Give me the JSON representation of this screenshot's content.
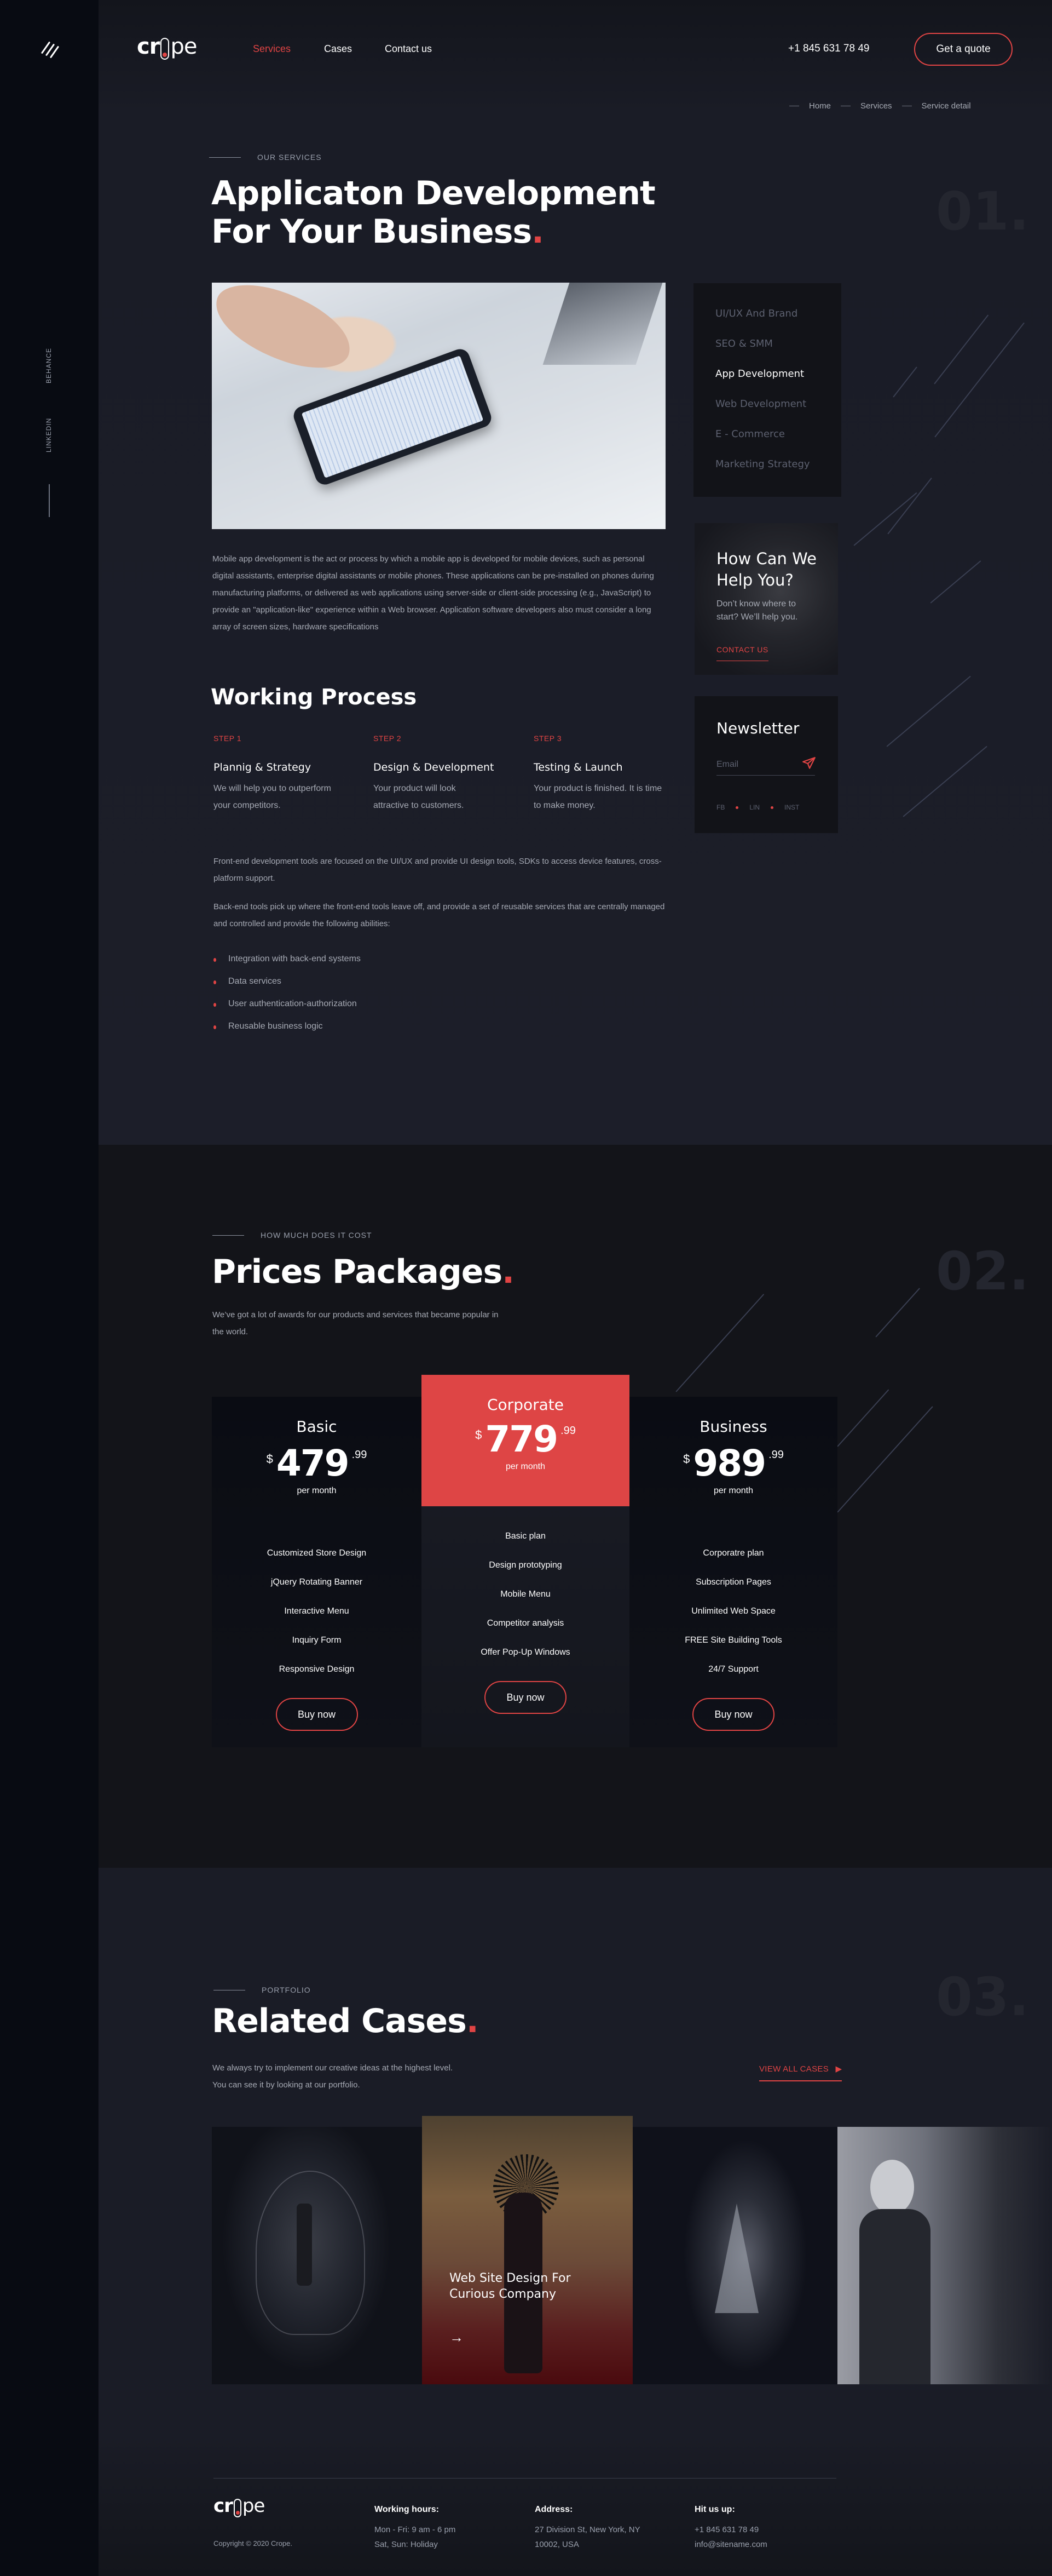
{
  "brand": {
    "logo_left": "cr",
    "logo_right": "pe",
    "accent": "#e04444"
  },
  "sidebar": {
    "social_links": [
      "BEHANCE",
      "LINKEDIN"
    ]
  },
  "header": {
    "nav": [
      {
        "label": "Services",
        "active": true
      },
      {
        "label": "Cases",
        "active": false
      },
      {
        "label": "Contact us",
        "active": false
      }
    ],
    "phone": "+1 845 631 78 49",
    "quote_button": "Get a quote"
  },
  "breadcrumb": [
    "Home",
    "Services",
    "Service detail"
  ],
  "service": {
    "eyebrow": "OUR SERVICES",
    "title_line1": "Applicaton Development",
    "title_line2": "For Your Business",
    "title_dot": ".",
    "section_number": "01.",
    "intro": "Mobile app development is the act or process by which a mobile app is developed for mobile devices, such as personal digital assistants, enterprise digital assistants or mobile phones. These applications can be pre-installed on phones during manufacturing platforms, or delivered as web applications using server-side or client-side processing (e.g., JavaScript) to provide an \"application-like\" experience within a Web browser. Application software developers also must consider a long array of screen sizes, hardware specifications",
    "process_title": "Working Process",
    "steps": [
      {
        "label": "STEP 1",
        "title": "Plannig & Strategy",
        "text": "We will help you to outperform your competitors."
      },
      {
        "label": "STEP 2",
        "title": "Design & Development",
        "text": "Your product will look attractive to customers."
      },
      {
        "label": "STEP 3",
        "title": "Testing & Launch",
        "text": "Your product is finished. It is time to make money."
      }
    ],
    "para2": "Front-end development tools are focused on the UI/UX and provide UI design tools, SDKs to access device features, cross-platform support.",
    "para3": "Back-end tools pick up where the front-end tools leave off, and provide a set of reusable services that are centrally managed and controlled and provide the following abilities:",
    "bullets": [
      "Integration with back-end systems",
      "Data services",
      "User authentication-authorization",
      "Reusable business logic"
    ]
  },
  "service_menu": [
    {
      "label": "UI/UX And Brand",
      "active": false
    },
    {
      "label": "SEO & SMM",
      "active": false
    },
    {
      "label": "App Development",
      "active": true
    },
    {
      "label": "Web Development",
      "active": false
    },
    {
      "label": "E - Commerce",
      "active": false
    },
    {
      "label": "Marketing Strategy",
      "active": false
    }
  ],
  "help": {
    "title": "How Can We Help You?",
    "text": "Don’t know where to start? We’ll help you.",
    "cta": "CONTACT US"
  },
  "newsletter": {
    "title": "Newsletter",
    "placeholder": "Email",
    "social": [
      "FB",
      "LIN",
      "INST"
    ]
  },
  "pricing": {
    "eyebrow": "HOW MUCH DOES IT COST",
    "title": "Prices Packages",
    "title_dot": ".",
    "section_number": "02.",
    "subtitle": "We’ve got a lot of awards for our products and services that became popular in the world.",
    "plans": [
      {
        "name": "Basic",
        "currency": "$",
        "amount": "479",
        "cents": ".99",
        "period": "per month",
        "featured": false,
        "features": [
          "Customized Store Design",
          "jQuery Rotating Banner",
          "Interactive Menu",
          "Inquiry Form",
          "Responsive Design"
        ],
        "button": "Buy now"
      },
      {
        "name": "Corporate",
        "currency": "$",
        "amount": "779",
        "cents": ".99",
        "period": "per month",
        "featured": true,
        "features": [
          "Basic plan",
          "Design prototyping",
          "Mobile Menu",
          "Competitor analysis",
          "Offer Pop-Up Windows"
        ],
        "button": "Buy now"
      },
      {
        "name": "Business",
        "currency": "$",
        "amount": "989",
        "cents": ".99",
        "period": "per month",
        "featured": false,
        "features": [
          "Corporatre plan",
          "Subscription Pages",
          "Unlimited Web Space",
          "FREE Site Building Tools",
          "24/7 Support"
        ],
        "button": "Buy now"
      }
    ]
  },
  "cases": {
    "eyebrow": "PORTFOLIO",
    "title": "Related Cases",
    "title_dot": ".",
    "section_number": "03.",
    "subtitle_line1": "We always try to implement our creative ideas at the highest level.",
    "subtitle_line2": "You can see it by looking at our portfolio.",
    "view_all": "VIEW ALL CASES",
    "items": [
      {
        "image": "lightbulb-businessman-photo",
        "caption": ""
      },
      {
        "image": "woman-crown-forest-photo",
        "caption": "Web Site Design For Curious Company"
      },
      {
        "image": "dissolving-stairs-photo",
        "caption": ""
      },
      {
        "image": "woman-with-sword-photo",
        "caption": ""
      }
    ]
  },
  "footer": {
    "copyright": "Copyright © 2020 Crope.",
    "hours_title": "Working hours:",
    "hours": [
      "Mon - Fri: 9 am - 6 pm",
      "Sat, Sun: Holiday"
    ],
    "address_title": "Address:",
    "address": [
      "27 Division St, New York, NY",
      "10002, USA"
    ],
    "contact_title": "Hit us up:",
    "contact": [
      "+1 845 631 78 49",
      "info@sitename.com"
    ]
  }
}
